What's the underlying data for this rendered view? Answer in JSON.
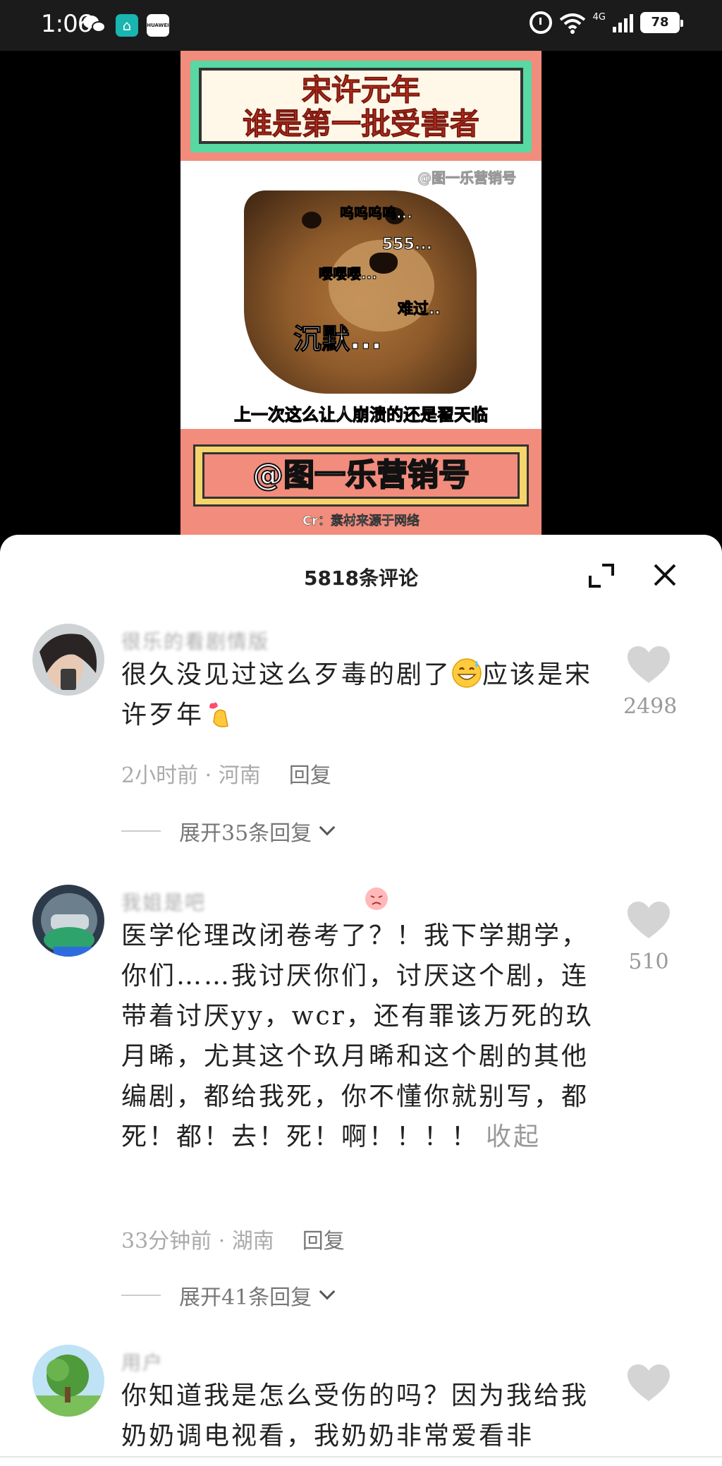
{
  "status_bar": {
    "time": "1:06",
    "network": "4G",
    "battery": "78"
  },
  "video": {
    "title_line1": "宋许元年",
    "title_line2": "谁是第一批受害者",
    "watermark": "@图一乐营销号",
    "dog_text_1": "呜呜呜呜...",
    "dog_text_2": "555...",
    "dog_text_3": "嘤嘤嘤...",
    "dog_text_4": "难过..",
    "dog_text_5": "沉默...",
    "caption": "上一次这么让人崩溃的还是翟天临",
    "handle": "@图一乐营销号",
    "credit": "Cr：素材来源于网络"
  },
  "comments_header": {
    "title": "5818条评论"
  },
  "comments": [
    {
      "username": "很乐的看剧情版",
      "text": "很久没见过这么歹毒的剧了",
      "text_after_emoji": "应该是宋许歹年",
      "time_location": "2小时前 · 河南",
      "reply_label": "回复",
      "expand_label": "展开35条回复",
      "likes": "2498"
    },
    {
      "username": "我姐是吧",
      "text": "医学伦理改闭卷考了？！我下学期学，你们……我讨厌你们，讨厌这个剧，连带着讨厌yy，wcr，还有罪该万死的玖月晞，尤其这个玖月晞和这个剧的其他编剧，都给我死，你不懂你就别写，都死！都！去！死！啊！！！！",
      "fold_label": "收起",
      "time_location": "33分钟前 · 湖南",
      "reply_label": "回复",
      "expand_label": "展开41条回复",
      "likes": "510"
    },
    {
      "username": "用户",
      "text": "你知道我是怎么受伤的吗？因为我给我奶奶调电视看，我奶奶非常爱看非",
      "likes": ""
    }
  ],
  "colors": {
    "poster_bg": "#f28c7c",
    "banner_green": "#58d8a3",
    "title_red": "#e33a27",
    "meta_gray": "#aaaaaa",
    "heart_gray": "#d4d4d4"
  }
}
